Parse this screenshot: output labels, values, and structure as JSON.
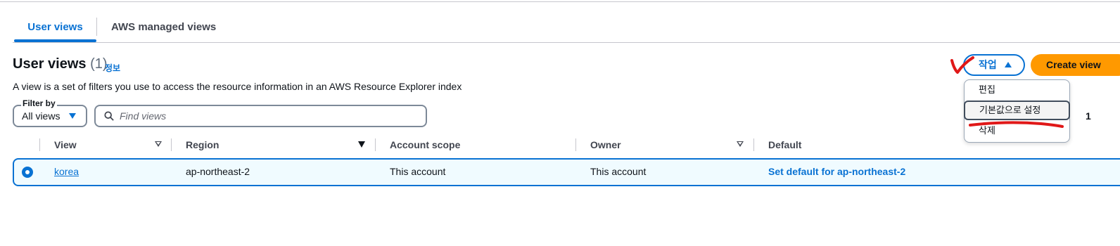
{
  "tabs": {
    "user_views": "User views",
    "aws_managed_views": "AWS managed views"
  },
  "header": {
    "title": "User views",
    "count": "(1)",
    "info": "정보",
    "description": "A view is a set of filters you use to access the resource information in an AWS Resource Explorer index"
  },
  "actions": {
    "actions_label": "작업",
    "create_label": "Create view"
  },
  "menu": {
    "items": [
      "편집",
      "기본값으로 설정",
      "삭제"
    ]
  },
  "pagination": {
    "current_page": "1"
  },
  "filter": {
    "label": "Filter by",
    "selected": "All views",
    "search_placeholder": "Find views"
  },
  "table": {
    "headers": [
      "View",
      "Region",
      "Account scope",
      "Owner",
      "Default"
    ],
    "rows": [
      {
        "view": "korea",
        "region": "ap-northeast-2",
        "account_scope": "This account",
        "owner": "This account",
        "default": "Set default for ap-northeast-2"
      }
    ]
  },
  "colors": {
    "accent": "#0972d3",
    "primary_button": "#ff9900",
    "annotation": "#e01818"
  }
}
